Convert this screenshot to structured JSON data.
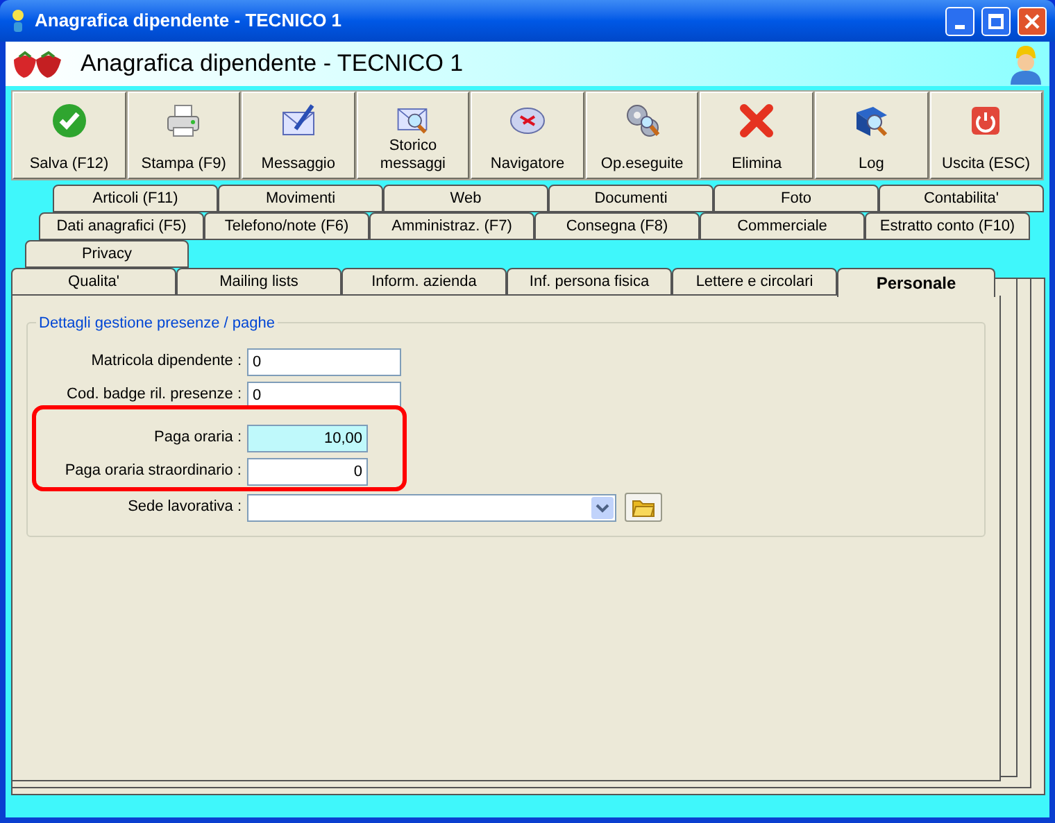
{
  "window": {
    "title": "Anagrafica dipendente - TECNICO 1"
  },
  "header": {
    "title": "Anagrafica dipendente - TECNICO 1"
  },
  "toolbar": {
    "buttons": [
      {
        "label": "Salva (F12)",
        "kind": "check"
      },
      {
        "label": "Stampa (F9)",
        "kind": "printer"
      },
      {
        "label": "Messaggio",
        "kind": "mail"
      },
      {
        "label": "Storico messaggi",
        "kind": "mailsearch"
      },
      {
        "label": "Navigatore",
        "kind": "compass"
      },
      {
        "label": "Op.eseguite",
        "kind": "gears"
      },
      {
        "label": "Elimina",
        "kind": "cross"
      },
      {
        "label": "Log",
        "kind": "book"
      },
      {
        "label": "Uscita (ESC)",
        "kind": "power"
      }
    ]
  },
  "tab_rows": [
    [
      {
        "label": "Articoli (F11)",
        "selected": false
      },
      {
        "label": "Movimenti",
        "selected": false
      },
      {
        "label": "Web",
        "selected": false
      },
      {
        "label": "Documenti",
        "selected": false
      },
      {
        "label": "Foto",
        "selected": false
      },
      {
        "label": "Contabilita'",
        "selected": false
      }
    ],
    [
      {
        "label": "Dati anagrafici (F5)",
        "selected": false
      },
      {
        "label": "Telefono/note (F6)",
        "selected": false
      },
      {
        "label": "Amministraz. (F7)",
        "selected": false
      },
      {
        "label": "Consegna (F8)",
        "selected": false
      },
      {
        "label": "Commerciale",
        "selected": false
      },
      {
        "label": "Estratto conto (F10)",
        "selected": false
      }
    ],
    [
      {
        "label": "Privacy",
        "selected": false
      }
    ],
    [
      {
        "label": "Qualita'",
        "selected": false
      },
      {
        "label": "Mailing lists",
        "selected": false
      },
      {
        "label": "Inform. azienda",
        "selected": false
      },
      {
        "label": "Inf. persona fisica",
        "selected": false
      },
      {
        "label": "Lettere e circolari",
        "selected": false
      },
      {
        "label": "Personale",
        "selected": true
      }
    ]
  ],
  "group": {
    "title": "Dettagli gestione presenze / paghe",
    "fields": [
      {
        "label": "Matricola dipendente :",
        "value": "0",
        "kind": "text",
        "focused": false
      },
      {
        "label": "Cod. badge ril. presenze :",
        "value": "0",
        "kind": "text",
        "focused": false
      },
      {
        "label": "Paga oraria :",
        "value": "10,00",
        "kind": "number",
        "focused": true
      },
      {
        "label": "Paga oraria straordinario :",
        "value": "0",
        "kind": "number",
        "focused": false
      },
      {
        "label": "Sede lavorativa :",
        "kind": "combo",
        "focused": false
      }
    ]
  }
}
